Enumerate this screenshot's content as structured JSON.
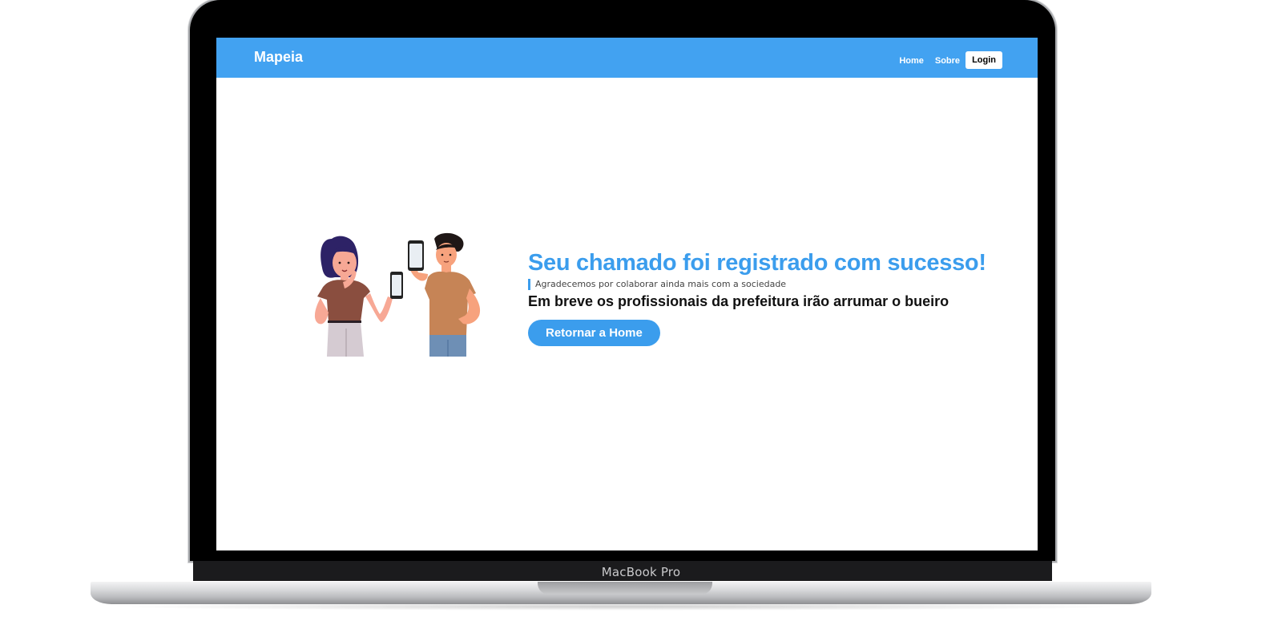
{
  "device": {
    "model_label": "MacBook Pro"
  },
  "navbar": {
    "brand": "Mapeia",
    "links": [
      {
        "label": "Home"
      },
      {
        "label": "Sobre"
      }
    ],
    "login_label": "Login"
  },
  "main": {
    "headline": "Seu chamado foi registrado com sucesso!",
    "subtitle": "Agradecemos por colaborar ainda mais com a sociedade",
    "message": "Em breve os profissionais da prefeitura irão arrumar o bueiro",
    "cta_label": "Retornar a Home",
    "illustration_icon": "people-holding-phones-illustration"
  },
  "colors": {
    "primary": "#42a2f1",
    "headline": "#3b9ded",
    "text": "#111111"
  }
}
